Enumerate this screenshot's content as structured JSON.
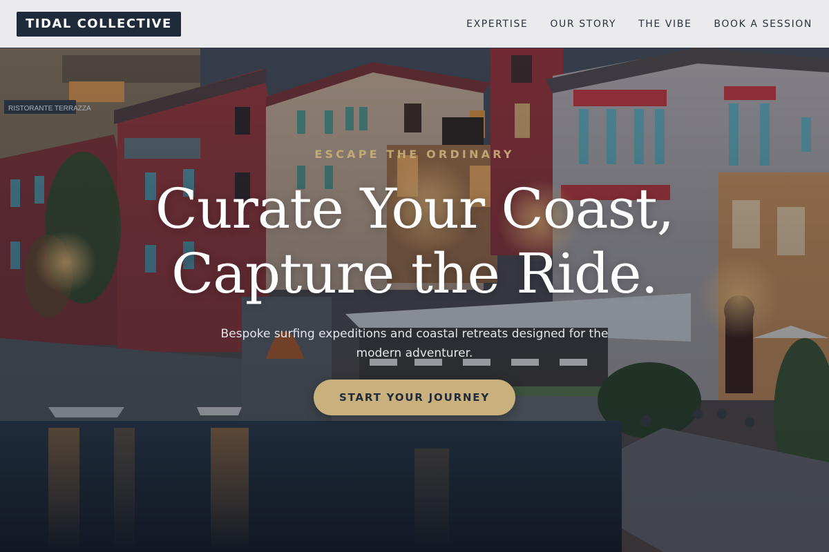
{
  "brand": {
    "logo_text": "TIDAL COLLECTIVE"
  },
  "nav": {
    "items": [
      {
        "label": "EXPERTISE"
      },
      {
        "label": "OUR STORY"
      },
      {
        "label": "THE VIBE"
      },
      {
        "label": "BOOK A SESSION"
      }
    ]
  },
  "hero": {
    "eyebrow": "ESCAPE THE ORDINARY",
    "headline_line1": "Curate Your Coast,",
    "headline_line2": "Capture the Ride.",
    "subtext": "Bespoke surfing expeditions and coastal retreats designed for the modern adventurer.",
    "cta_label": "START YOUR JOURNEY"
  },
  "background": {
    "sign_text": "RISTORANTE TERRAZZA"
  },
  "colors": {
    "header_bg": "#f2f3f5",
    "logo_bg": "#1f2a3a",
    "accent_gold": "#c9b07c",
    "nav_text": "#2a323e"
  }
}
